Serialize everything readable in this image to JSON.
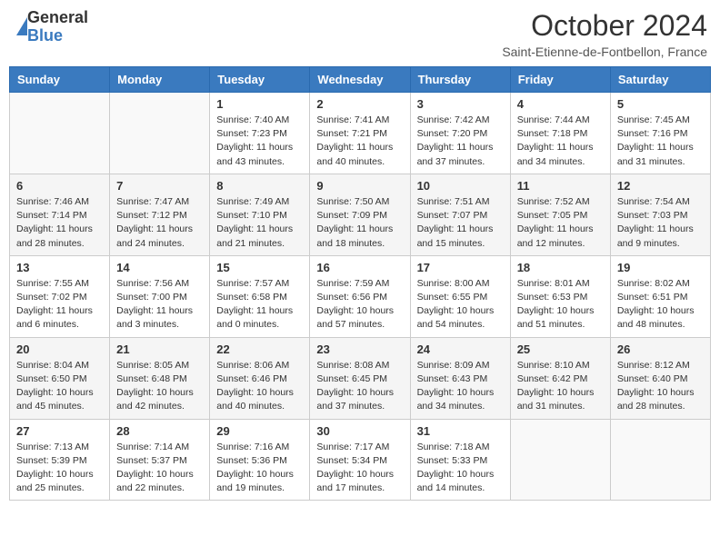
{
  "header": {
    "logo_general": "General",
    "logo_blue": "Blue",
    "month_title": "October 2024",
    "location": "Saint-Etienne-de-Fontbellon, France"
  },
  "days_of_week": [
    "Sunday",
    "Monday",
    "Tuesday",
    "Wednesday",
    "Thursday",
    "Friday",
    "Saturday"
  ],
  "weeks": [
    [
      {
        "num": "",
        "info": ""
      },
      {
        "num": "",
        "info": ""
      },
      {
        "num": "1",
        "info": "Sunrise: 7:40 AM\nSunset: 7:23 PM\nDaylight: 11 hours and 43 minutes."
      },
      {
        "num": "2",
        "info": "Sunrise: 7:41 AM\nSunset: 7:21 PM\nDaylight: 11 hours and 40 minutes."
      },
      {
        "num": "3",
        "info": "Sunrise: 7:42 AM\nSunset: 7:20 PM\nDaylight: 11 hours and 37 minutes."
      },
      {
        "num": "4",
        "info": "Sunrise: 7:44 AM\nSunset: 7:18 PM\nDaylight: 11 hours and 34 minutes."
      },
      {
        "num": "5",
        "info": "Sunrise: 7:45 AM\nSunset: 7:16 PM\nDaylight: 11 hours and 31 minutes."
      }
    ],
    [
      {
        "num": "6",
        "info": "Sunrise: 7:46 AM\nSunset: 7:14 PM\nDaylight: 11 hours and 28 minutes."
      },
      {
        "num": "7",
        "info": "Sunrise: 7:47 AM\nSunset: 7:12 PM\nDaylight: 11 hours and 24 minutes."
      },
      {
        "num": "8",
        "info": "Sunrise: 7:49 AM\nSunset: 7:10 PM\nDaylight: 11 hours and 21 minutes."
      },
      {
        "num": "9",
        "info": "Sunrise: 7:50 AM\nSunset: 7:09 PM\nDaylight: 11 hours and 18 minutes."
      },
      {
        "num": "10",
        "info": "Sunrise: 7:51 AM\nSunset: 7:07 PM\nDaylight: 11 hours and 15 minutes."
      },
      {
        "num": "11",
        "info": "Sunrise: 7:52 AM\nSunset: 7:05 PM\nDaylight: 11 hours and 12 minutes."
      },
      {
        "num": "12",
        "info": "Sunrise: 7:54 AM\nSunset: 7:03 PM\nDaylight: 11 hours and 9 minutes."
      }
    ],
    [
      {
        "num": "13",
        "info": "Sunrise: 7:55 AM\nSunset: 7:02 PM\nDaylight: 11 hours and 6 minutes."
      },
      {
        "num": "14",
        "info": "Sunrise: 7:56 AM\nSunset: 7:00 PM\nDaylight: 11 hours and 3 minutes."
      },
      {
        "num": "15",
        "info": "Sunrise: 7:57 AM\nSunset: 6:58 PM\nDaylight: 11 hours and 0 minutes."
      },
      {
        "num": "16",
        "info": "Sunrise: 7:59 AM\nSunset: 6:56 PM\nDaylight: 10 hours and 57 minutes."
      },
      {
        "num": "17",
        "info": "Sunrise: 8:00 AM\nSunset: 6:55 PM\nDaylight: 10 hours and 54 minutes."
      },
      {
        "num": "18",
        "info": "Sunrise: 8:01 AM\nSunset: 6:53 PM\nDaylight: 10 hours and 51 minutes."
      },
      {
        "num": "19",
        "info": "Sunrise: 8:02 AM\nSunset: 6:51 PM\nDaylight: 10 hours and 48 minutes."
      }
    ],
    [
      {
        "num": "20",
        "info": "Sunrise: 8:04 AM\nSunset: 6:50 PM\nDaylight: 10 hours and 45 minutes."
      },
      {
        "num": "21",
        "info": "Sunrise: 8:05 AM\nSunset: 6:48 PM\nDaylight: 10 hours and 42 minutes."
      },
      {
        "num": "22",
        "info": "Sunrise: 8:06 AM\nSunset: 6:46 PM\nDaylight: 10 hours and 40 minutes."
      },
      {
        "num": "23",
        "info": "Sunrise: 8:08 AM\nSunset: 6:45 PM\nDaylight: 10 hours and 37 minutes."
      },
      {
        "num": "24",
        "info": "Sunrise: 8:09 AM\nSunset: 6:43 PM\nDaylight: 10 hours and 34 minutes."
      },
      {
        "num": "25",
        "info": "Sunrise: 8:10 AM\nSunset: 6:42 PM\nDaylight: 10 hours and 31 minutes."
      },
      {
        "num": "26",
        "info": "Sunrise: 8:12 AM\nSunset: 6:40 PM\nDaylight: 10 hours and 28 minutes."
      }
    ],
    [
      {
        "num": "27",
        "info": "Sunrise: 7:13 AM\nSunset: 5:39 PM\nDaylight: 10 hours and 25 minutes."
      },
      {
        "num": "28",
        "info": "Sunrise: 7:14 AM\nSunset: 5:37 PM\nDaylight: 10 hours and 22 minutes."
      },
      {
        "num": "29",
        "info": "Sunrise: 7:16 AM\nSunset: 5:36 PM\nDaylight: 10 hours and 19 minutes."
      },
      {
        "num": "30",
        "info": "Sunrise: 7:17 AM\nSunset: 5:34 PM\nDaylight: 10 hours and 17 minutes."
      },
      {
        "num": "31",
        "info": "Sunrise: 7:18 AM\nSunset: 5:33 PM\nDaylight: 10 hours and 14 minutes."
      },
      {
        "num": "",
        "info": ""
      },
      {
        "num": "",
        "info": ""
      }
    ]
  ]
}
